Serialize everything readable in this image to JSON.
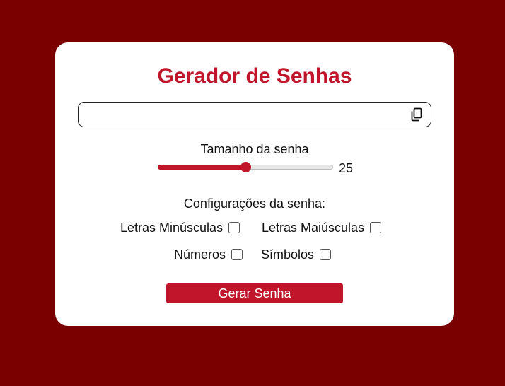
{
  "title": "Gerador de Senhas",
  "password": {
    "value": "",
    "placeholder": ""
  },
  "length": {
    "label": "Tamanho da senha",
    "value": "25",
    "min": 1,
    "max": 50,
    "fraction": 0.5
  },
  "config": {
    "label": "Configurações da senha:",
    "options": [
      {
        "label": "Letras Minúsculas",
        "checked": false
      },
      {
        "label": "Letras Maiúsculas",
        "checked": false
      },
      {
        "label": "Números",
        "checked": false
      },
      {
        "label": "Símbolos",
        "checked": false
      }
    ]
  },
  "button": {
    "label": "Gerar Senha"
  },
  "icons": {
    "copy": "copy-icon"
  },
  "colors": {
    "background": "#7a0000",
    "accent": "#c0152a",
    "card": "#ffffff"
  }
}
